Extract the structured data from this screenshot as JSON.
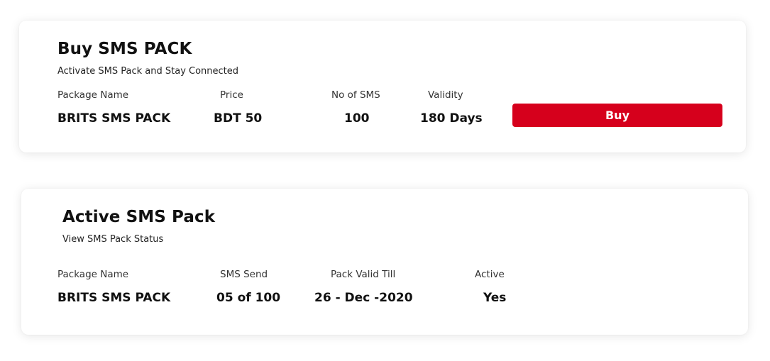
{
  "buy_pack": {
    "title": "Buy SMS PACK",
    "subtitle": "Activate SMS Pack and Stay Connected",
    "labels": {
      "package_name": "Package Name",
      "price": "Price",
      "no_of_sms": "No of SMS",
      "validity": "Validity"
    },
    "values": {
      "package_name": "BRITS SMS PACK",
      "price": "BDT 50",
      "no_of_sms": "100",
      "validity": "180 Days"
    },
    "buy_button_label": "Buy",
    "accent_color": "#d6001c"
  },
  "active_pack": {
    "title": "Active SMS Pack",
    "subtitle": "View SMS Pack Status",
    "labels": {
      "package_name": "Package Name",
      "sms_send": "SMS Send",
      "pack_valid_till": "Pack Valid Till",
      "active": "Active"
    },
    "values": {
      "package_name": "BRITS SMS PACK",
      "sms_send": "05 of 100",
      "pack_valid_till": "26 - Dec -2020",
      "active": "Yes"
    }
  }
}
